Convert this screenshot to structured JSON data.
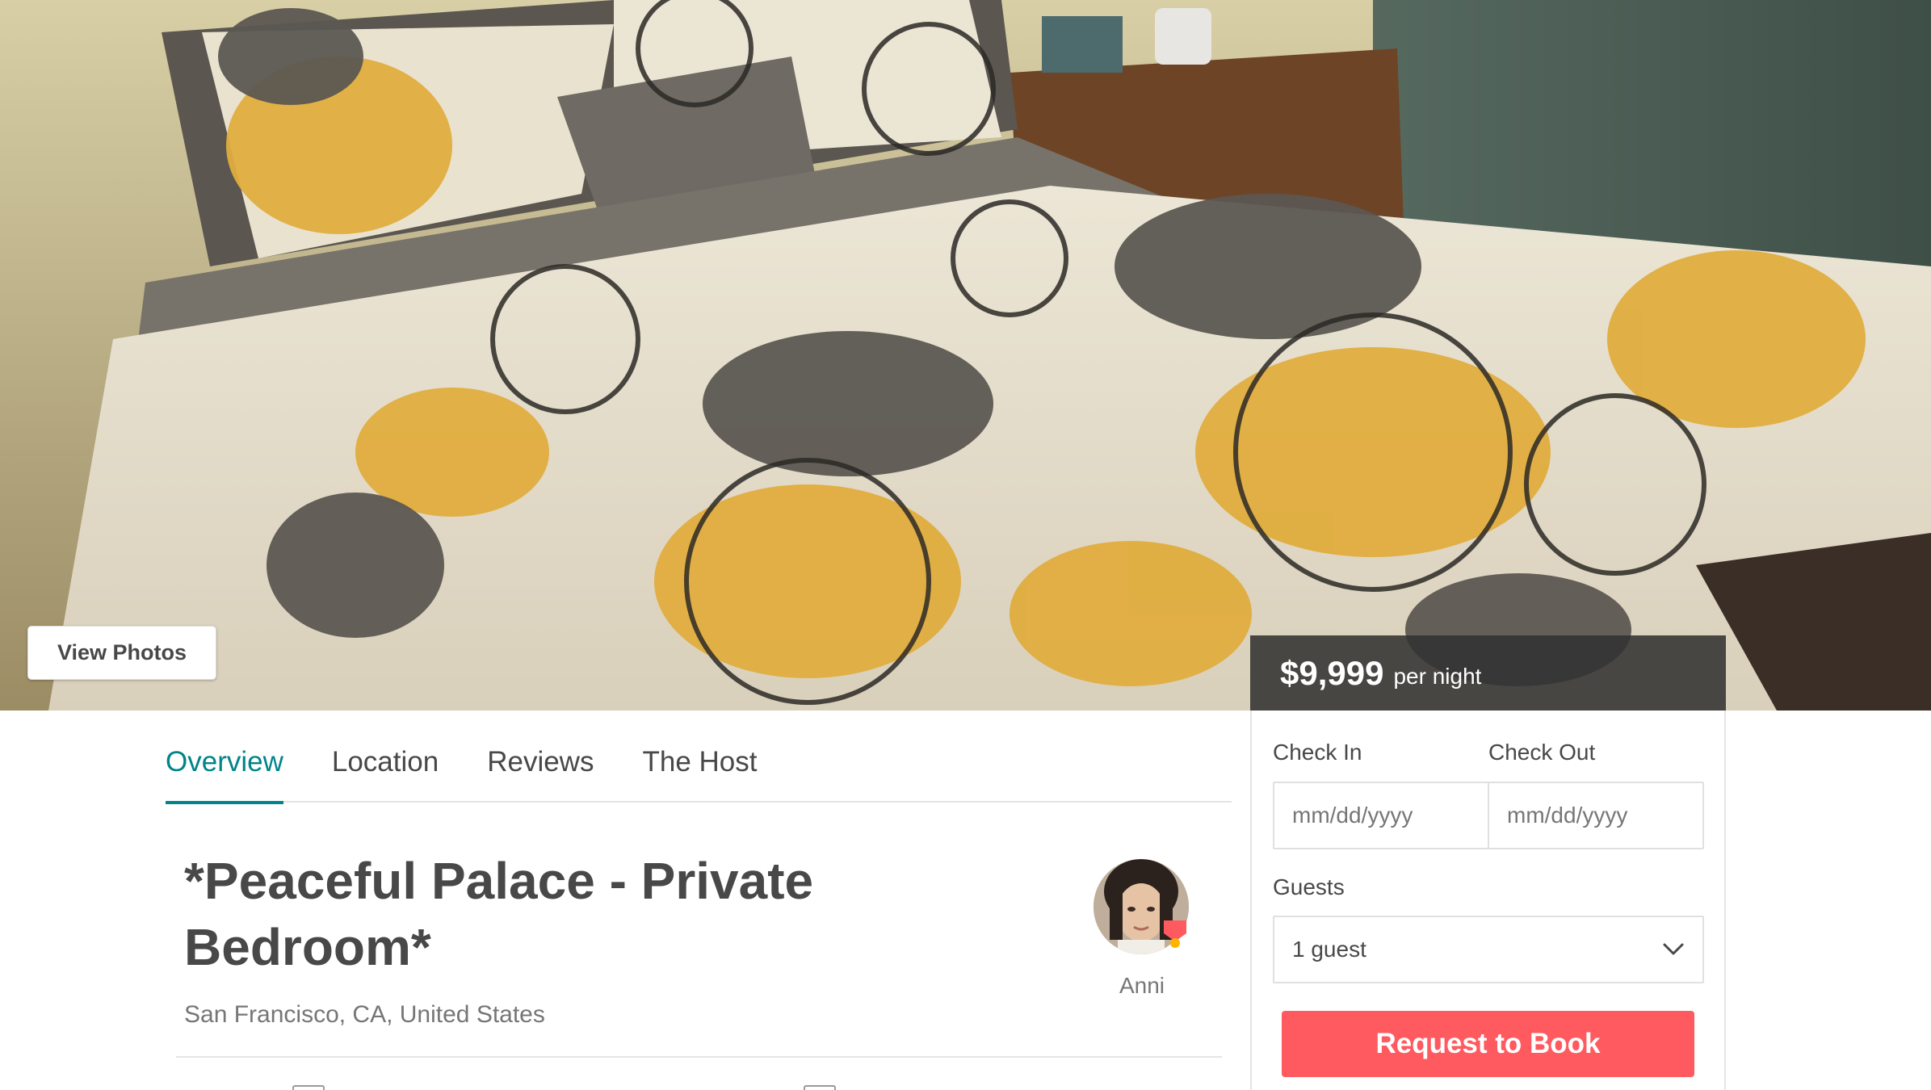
{
  "hero": {
    "view_photos_label": "View Photos",
    "price": "$9,999",
    "price_unit": "per night"
  },
  "tabs": [
    {
      "label": "Overview",
      "active": true
    },
    {
      "label": "Location",
      "active": false
    },
    {
      "label": "Reviews",
      "active": false
    },
    {
      "label": "The Host",
      "active": false
    }
  ],
  "listing": {
    "title": "*Peaceful Palace - Private Bedroom*",
    "location": "San Francisco, CA, United States"
  },
  "host": {
    "name": "Anni",
    "badge_icon": "superhost-badge-icon"
  },
  "booking": {
    "check_in_label": "Check In",
    "check_out_label": "Check Out",
    "check_in_placeholder": "mm/dd/yyyy",
    "check_out_placeholder": "mm/dd/yyyy",
    "guests_label": "Guests",
    "guests_value": "1 guest",
    "request_label": "Request to Book"
  },
  "colors": {
    "accent_teal": "#008489",
    "brand_coral": "#ff5a5f",
    "text_dark": "#484848",
    "text_muted": "#767676"
  }
}
